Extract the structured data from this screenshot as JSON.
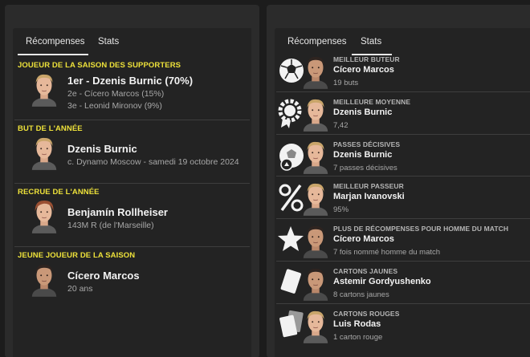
{
  "left_panel": {
    "tabs": [
      {
        "label": "Récompenses",
        "active": true
      },
      {
        "label": "Stats",
        "active": false
      }
    ],
    "awards": [
      {
        "category": "JOUEUR DE LA SAISON DES SUPPORTERS",
        "main": "1er - Dzenis Burnic (70%)",
        "lines": [
          "2e - Cícero Marcos (15%)",
          "3e - Leonid Mironov (9%)"
        ]
      },
      {
        "category": "BUT DE L'ANNÉE",
        "main": "Dzenis Burnic",
        "lines": [
          "c. Dynamo Moscow - samedi 19 octobre 2024"
        ]
      },
      {
        "category": "RECRUE DE L'ANNÉE",
        "main": "Benjamín Rollheiser",
        "lines": [
          "143M R (de l'Marseille)"
        ]
      },
      {
        "category": "JEUNE JOUEUR DE LA SAISON",
        "main": "Cícero Marcos",
        "lines": [
          "20 ans"
        ]
      }
    ]
  },
  "right_panel": {
    "tabs": [
      {
        "label": "Récompenses",
        "active": false
      },
      {
        "label": "Stats",
        "active": true
      }
    ],
    "stats": [
      {
        "category": "MEILLEUR BUTEUR",
        "player": "Cícero Marcos",
        "value": "19 buts",
        "icon": "football-icon"
      },
      {
        "category": "MEILLEURE MOYENNE",
        "player": "Dzenis Burnic",
        "value": "7,42",
        "icon": "rating-badge-icon"
      },
      {
        "category": "PASSES DÉCISIVES",
        "player": "Dzenis Burnic",
        "value": "7 passes décisives",
        "icon": "assist-ball-icon"
      },
      {
        "category": "MEILLEUR PASSEUR",
        "player": "Marjan Ivanovski",
        "value": "95%",
        "icon": "percent-icon"
      },
      {
        "category": "PLUS DE RÉCOMPENSES POUR HOMME DU MATCH",
        "player": "Cícero Marcos",
        "value": "7 fois nommé homme du match",
        "icon": "star-icon"
      },
      {
        "category": "CARTONS JAUNES",
        "player": "Astemir Gordyushenko",
        "value": "8 cartons jaunes",
        "icon": "yellow-card-icon"
      },
      {
        "category": "CARTONS ROUGES",
        "player": "Luis Rodas",
        "value": "1 carton rouge",
        "icon": "red-card-icon"
      }
    ]
  },
  "colors": {
    "category_yellow": "#ede13a",
    "panel_bg": "#2b2b2b",
    "inner_bg": "#232323",
    "page_bg": "#1c1c1c"
  }
}
